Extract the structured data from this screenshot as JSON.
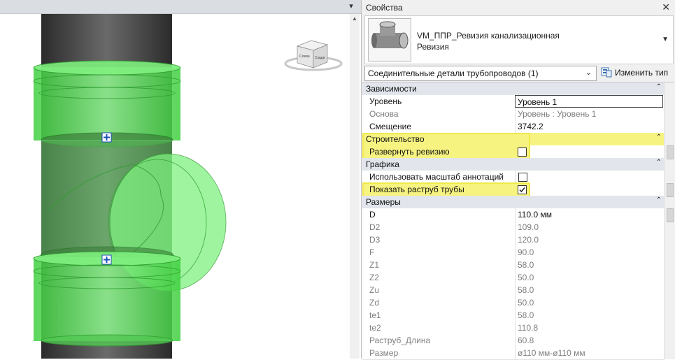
{
  "viewport": {
    "menu_icon": "dropdown-menu-icon",
    "view_cube": {
      "face_front": "Сзади",
      "face_left": "Слева"
    }
  },
  "panel": {
    "title": "Свойства",
    "close_icon": "close-icon",
    "type": {
      "name": "VM_ППР_Ревизия канализационная",
      "subtype": "Ревизия"
    },
    "filter": {
      "label": "Соединительные детали трубопроводов (1)"
    },
    "edit_type": {
      "label": "Изменить тип"
    },
    "groups": {
      "constraints": {
        "title": "Зависимости",
        "level_label": "Уровень",
        "level_value": "Уровень 1",
        "host_label": "Основа",
        "host_value": "Уровень : Уровень 1",
        "offset_label": "Смещение",
        "offset_value": "3742.2"
      },
      "construction": {
        "title": "Строительство",
        "expand_label": "Развернуть ревизию",
        "expand_checked": false
      },
      "graphics": {
        "title": "Графика",
        "annot_label": "Использовать масштаб аннотаций",
        "annot_checked": false,
        "socket_label": "Показать раструб трубы",
        "socket_checked": true
      },
      "dimensions": {
        "title": "Размеры",
        "rows": [
          {
            "name": "D",
            "value": "110.0 мм"
          },
          {
            "name": "D2",
            "value": "109.0"
          },
          {
            "name": "D3",
            "value": "120.0"
          },
          {
            "name": "F",
            "value": "90.0"
          },
          {
            "name": "Z1",
            "value": "58.0"
          },
          {
            "name": "Z2",
            "value": "50.0"
          },
          {
            "name": "Zu",
            "value": "58.0"
          },
          {
            "name": "Zd",
            "value": "50.0"
          },
          {
            "name": "te1",
            "value": "58.0"
          },
          {
            "name": "te2",
            "value": "110.8"
          },
          {
            "name": "Раструб_Длина",
            "value": "60.8"
          },
          {
            "name": "Размер",
            "value": "ø110 мм-ø110 мм"
          }
        ]
      }
    }
  },
  "colors": {
    "highlight": "#f6f381",
    "pipe_green": "#5ee85e",
    "pipe_dark": "#3a3a3a",
    "group_bg": "#e2e6ec"
  }
}
